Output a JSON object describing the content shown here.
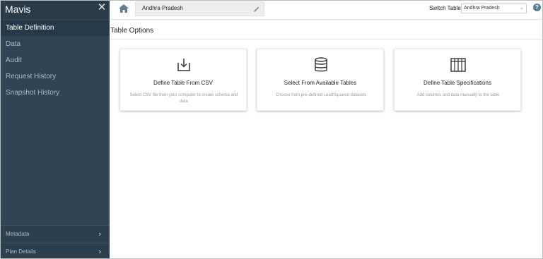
{
  "sidebar": {
    "app_title": "Mavis",
    "items": [
      {
        "label": "Table Definition",
        "active": true
      },
      {
        "label": "Data",
        "active": false
      },
      {
        "label": "Audit",
        "active": false
      },
      {
        "label": "Request History",
        "active": false
      },
      {
        "label": "Snapshot History",
        "active": false
      }
    ],
    "footer": [
      {
        "label": "Metadata"
      },
      {
        "label": "Plan Details"
      }
    ]
  },
  "topbar": {
    "table_name": "Andhra Pradesh",
    "switch_label": "Switch Table",
    "switch_value": "Andhra Pradesh"
  },
  "main": {
    "section_title": "Table Options",
    "cards": [
      {
        "title": "Define Table From CSV",
        "desc": "Select CSV file from your computer to create schema and data",
        "icon": "download-icon"
      },
      {
        "title": "Select From Available Tables",
        "desc": "Choose from pre-defined LeadSquared datasets",
        "icon": "database-icon"
      },
      {
        "title": "Define Table Specifications",
        "desc": "Add columns and data manually to the table",
        "icon": "table-icon"
      }
    ]
  },
  "colors": {
    "sidebar_bg": "#2f4454",
    "sidebar_active": "#26394a",
    "accent": "#5b7d95"
  }
}
